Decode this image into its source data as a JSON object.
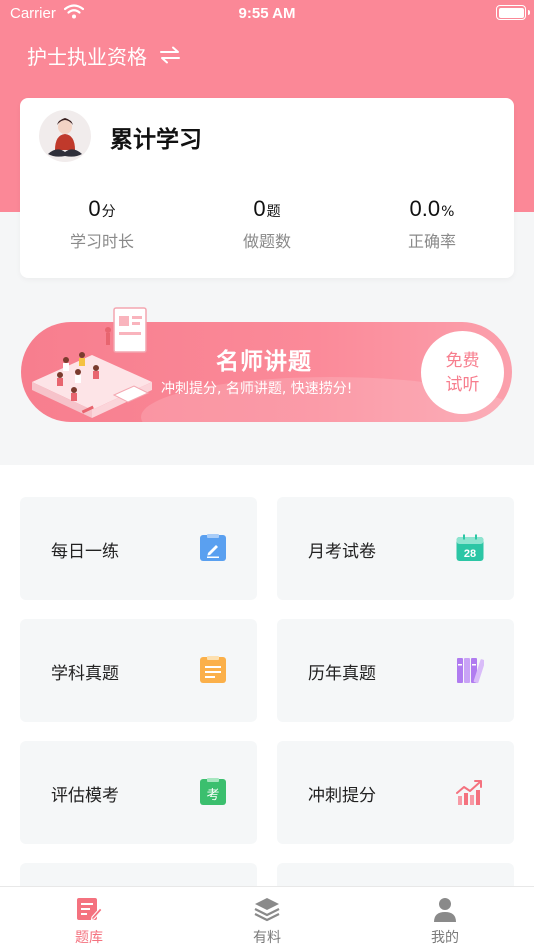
{
  "status_bar": {
    "carrier": "Carrier",
    "time": "9:55 AM"
  },
  "header": {
    "exam_name": "护士执业资格",
    "switch_icon": "swap-arrows-icon"
  },
  "study_card": {
    "title": "累计学习",
    "stats": [
      {
        "value": "0",
        "unit": "分",
        "label": "学习时长"
      },
      {
        "value": "0",
        "unit": "题",
        "label": "做题数"
      },
      {
        "value": "0.0",
        "unit": "%",
        "label": "正确率"
      }
    ]
  },
  "banner": {
    "title": "名师讲题",
    "subtitle": "冲刺提分, 名师讲题, 快速捞分!",
    "badge_line1": "免费",
    "badge_line2": "试听"
  },
  "tiles": [
    {
      "label": "每日一练",
      "icon": "notepad-pen-icon",
      "color": "#5aa0f0"
    },
    {
      "label": "月考试卷",
      "icon": "calendar-28-icon",
      "color": "#2cc6a5",
      "icon_text": "28"
    },
    {
      "label": "学科真题",
      "icon": "document-lines-icon",
      "color": "#fbb04a"
    },
    {
      "label": "历年真题",
      "icon": "books-icon",
      "color": "#b07cf0"
    },
    {
      "label": "评估模考",
      "icon": "exam-clipboard-icon",
      "color": "#3bbf6e",
      "icon_text": "考"
    },
    {
      "label": "冲刺提分",
      "icon": "rising-chart-icon",
      "color": "#f4727f"
    }
  ],
  "tab_bar": {
    "items": [
      {
        "label": "题库",
        "active": true
      },
      {
        "label": "有料",
        "active": false
      },
      {
        "label": "我的",
        "active": false
      }
    ]
  },
  "colors": {
    "brand_pink": "#fb8897",
    "tab_active": "#f4727f",
    "tab_inactive": "#7a7a7a"
  }
}
